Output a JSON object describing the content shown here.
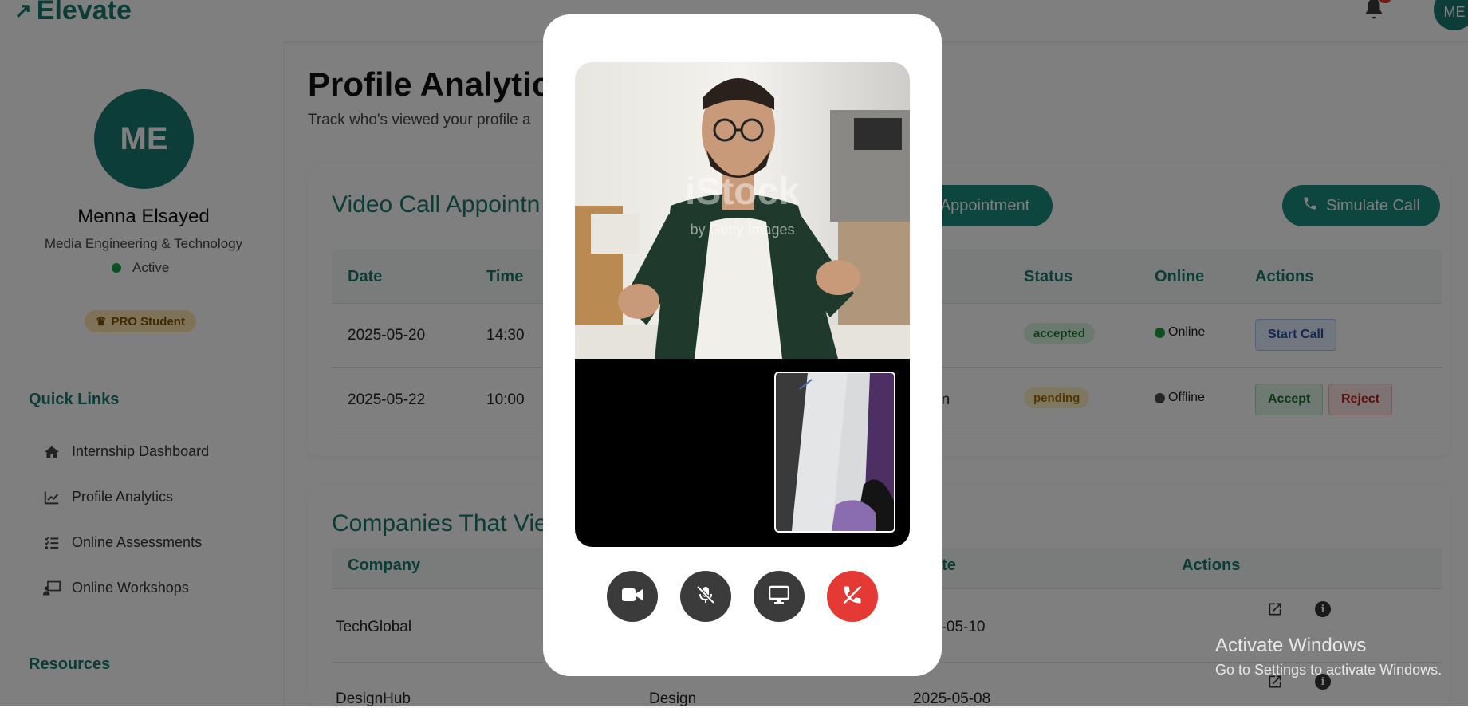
{
  "app": {
    "logo_text": "Elevate",
    "top_avatar_initials": "ME"
  },
  "profile": {
    "initials": "ME",
    "name": "Menna Elsayed",
    "major": "Media Engineering & Technology",
    "status": "Active",
    "badge": "PRO Student"
  },
  "sidebar": {
    "quick_links_title": "Quick Links",
    "items": [
      {
        "label": "Internship Dashboard",
        "icon": "home-icon"
      },
      {
        "label": "Profile Analytics",
        "icon": "chart-line-icon"
      },
      {
        "label": "Online Assessments",
        "icon": "list-check-icon"
      },
      {
        "label": "Online Workshops",
        "icon": "chalkboard-teacher-icon"
      }
    ],
    "resources_title": "Resources"
  },
  "page": {
    "title": "Profile Analytics",
    "subtitle": "Track who's viewed your profile a"
  },
  "appointments": {
    "title": "Video Call Appointn",
    "add_button": "Appointment",
    "simulate_button": "Simulate Call",
    "headers": [
      "Date",
      "Time",
      "Status",
      "Online",
      "Actions"
    ],
    "rows": [
      {
        "date": "2025-05-20",
        "time": "14:30",
        "partial": "",
        "status": "accepted",
        "online": "Online",
        "actions": [
          "Start Call"
        ]
      },
      {
        "date": "2025-05-22",
        "time": "10:00",
        "partial": "on",
        "status": "pending",
        "online": "Offline",
        "actions": [
          "Accept",
          "Reject"
        ]
      }
    ],
    "colors": {
      "online": "#1f9d3f",
      "offline": "#4a4a4a"
    }
  },
  "companies": {
    "title": "Companies That Vie",
    "headers": [
      "Company",
      "ate",
      "Actions"
    ],
    "rows": [
      {
        "company": "TechGlobal",
        "industry": "",
        "date": "5-05-10"
      },
      {
        "company": "DesignHub",
        "industry": "Design",
        "date": "2025-05-08"
      }
    ]
  },
  "call": {
    "watermark_line1": "iStock",
    "watermark_line2": "by Getty Images",
    "controls": [
      "video-camera-icon",
      "microphone-slash-icon",
      "desktop-share-icon",
      "phone-hangup-icon"
    ]
  },
  "windows": {
    "line1": "Activate Windows",
    "line2": "Go to Settings to activate Windows."
  },
  "colors": {
    "brand": "#17796f",
    "danger": "#e53935"
  }
}
